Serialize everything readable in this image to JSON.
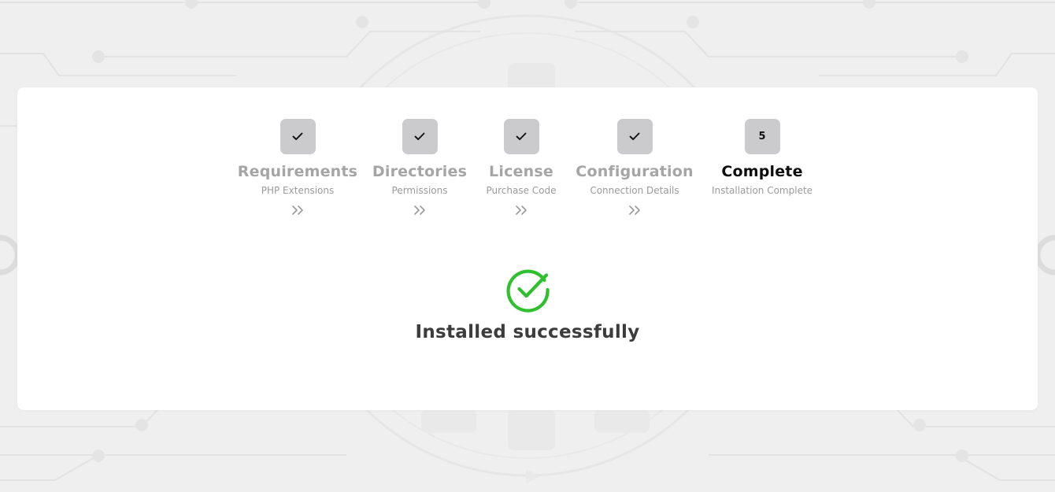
{
  "steps": [
    {
      "title": "Requirements",
      "subtitle": "PHP Extensions",
      "status": "done",
      "icon": "check-icon"
    },
    {
      "title": "Directories",
      "subtitle": "Permissions",
      "status": "done",
      "icon": "check-icon"
    },
    {
      "title": "License",
      "subtitle": "Purchase Code",
      "status": "done",
      "icon": "check-icon"
    },
    {
      "title": "Configuration",
      "subtitle": "Connection Details",
      "status": "done",
      "icon": "check-icon"
    },
    {
      "title": "Complete",
      "subtitle": "Installation Complete",
      "status": "active",
      "number": "5"
    }
  ],
  "result": {
    "message": "Installed successfully",
    "icon": "check-circle-icon",
    "color": "#2ec02e"
  },
  "colors": {
    "page_background": "#efefef",
    "card": "#ffffff",
    "step_box": "#cbcbcd",
    "step_title_inactive": "#a5a5a5",
    "step_title_active": "#0e0e0e"
  }
}
